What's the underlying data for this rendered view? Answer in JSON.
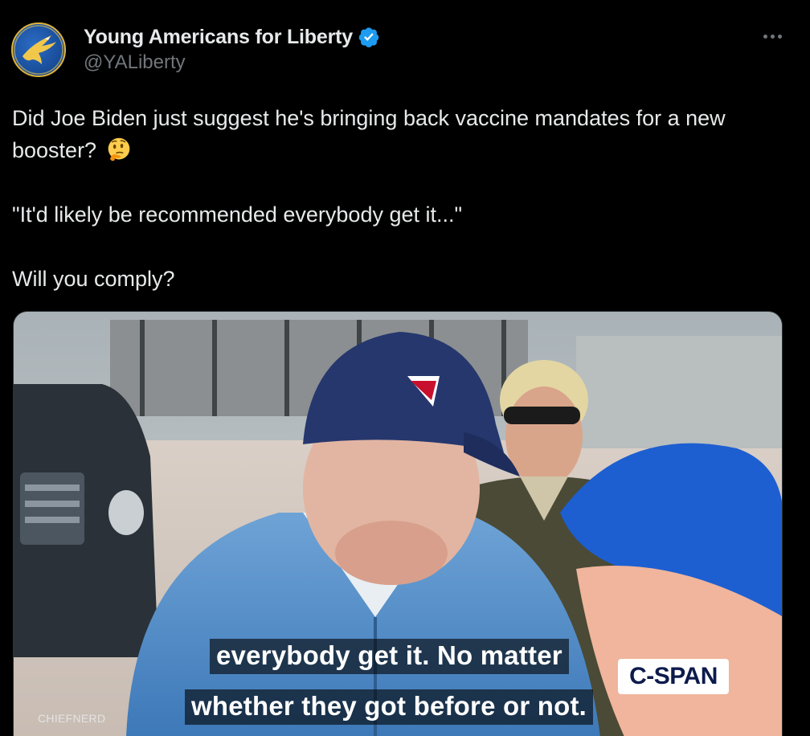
{
  "tweet": {
    "author": {
      "name": "Young Americans for Liberty",
      "handle": "@YALiberty",
      "verified": true,
      "avatar_icon": "eagle-logo-icon",
      "verified_icon": "verified-badge-icon"
    },
    "more_icon": "more-options-icon",
    "text_lines": [
      "Did Joe Biden just suggest he's bringing back vaccine mandates for a new",
      "booster?",
      "\"It'd likely be recommended everybody get it...\"",
      "Will you comply?"
    ],
    "emoji": "thinking-face-emoji",
    "media": {
      "type": "video",
      "caption_lines": [
        "everybody get it. No matter",
        "whether they got before or not."
      ],
      "network_badge": "C-SPAN",
      "watermark": "CHIEFNERD"
    }
  },
  "colors": {
    "background": "#000000",
    "text_primary": "#e7e9ea",
    "text_secondary": "#71767b",
    "verified_blue": "#1d9bf0",
    "border": "#2f3336"
  }
}
